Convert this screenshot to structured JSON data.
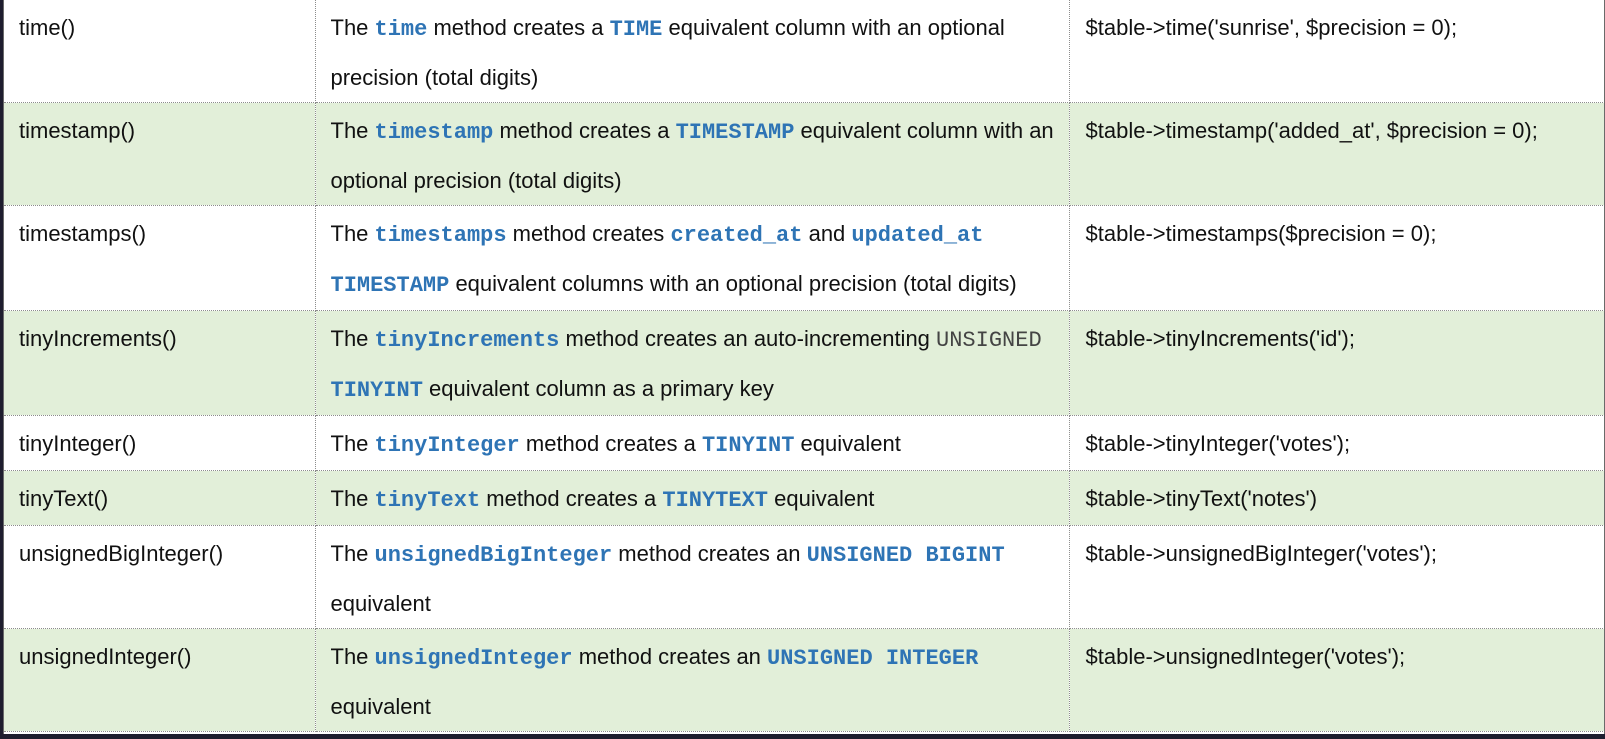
{
  "rows": [
    {
      "method": "time()",
      "desc": [
        {
          "t": "The ",
          "k": "text"
        },
        {
          "t": "time",
          "k": "kw"
        },
        {
          "t": " method creates a ",
          "k": "text"
        },
        {
          "t": "TIME",
          "k": "kw"
        },
        {
          "t": " equivalent column with an optional precision (total digits)",
          "k": "text"
        }
      ],
      "example": "$table->time('sunrise', $precision = 0);"
    },
    {
      "method": "timestamp()",
      "desc": [
        {
          "t": "The ",
          "k": "text"
        },
        {
          "t": "timestamp",
          "k": "kw"
        },
        {
          "t": " method creates a ",
          "k": "text"
        },
        {
          "t": "TIMESTAMP",
          "k": "kw"
        },
        {
          "t": " equivalent column with an optional precision (total digits)",
          "k": "text"
        }
      ],
      "example": "$table->timestamp('added_at', $precision = 0);"
    },
    {
      "method": "timestamps()",
      "desc": [
        {
          "t": "The ",
          "k": "text"
        },
        {
          "t": "timestamps",
          "k": "kw"
        },
        {
          "t": " method creates ",
          "k": "text"
        },
        {
          "t": "created_at",
          "k": "kw"
        },
        {
          "t": " and ",
          "k": "text"
        },
        {
          "t": "updated_at",
          "k": "kw"
        },
        {
          "t": " ",
          "k": "text"
        },
        {
          "t": "TIMESTAMP",
          "k": "kw"
        },
        {
          "t": " equivalent columns with an optional precision (total digits)",
          "k": "text"
        }
      ],
      "example": "$table->timestamps($precision = 0);"
    },
    {
      "method": "tinyIncrements()",
      "desc": [
        {
          "t": "The ",
          "k": "text"
        },
        {
          "t": "tinyIncrements",
          "k": "kw"
        },
        {
          "t": " method creates an auto-incrementing ",
          "k": "text"
        },
        {
          "t": "UNSIGNED",
          "k": "plain"
        },
        {
          "t": " ",
          "k": "text"
        },
        {
          "t": "TINYINT",
          "k": "kw"
        },
        {
          "t": " equivalent column as a primary key",
          "k": "text"
        }
      ],
      "example": "$table->tinyIncrements('id');"
    },
    {
      "method": "tinyInteger()",
      "desc": [
        {
          "t": "The ",
          "k": "text"
        },
        {
          "t": "tinyInteger",
          "k": "kw"
        },
        {
          "t": " method creates a ",
          "k": "text"
        },
        {
          "t": "TINYINT",
          "k": "kw"
        },
        {
          "t": " equivalent",
          "k": "text"
        }
      ],
      "example": "$table->tinyInteger('votes');"
    },
    {
      "method": "tinyText()",
      "desc": [
        {
          "t": "The ",
          "k": "text"
        },
        {
          "t": "tinyText",
          "k": "kw"
        },
        {
          "t": " method creates a ",
          "k": "text"
        },
        {
          "t": "TINYTEXT",
          "k": "kw"
        },
        {
          "t": " equivalent",
          "k": "text"
        }
      ],
      "example": "$table->tinyText('notes')"
    },
    {
      "method": "unsignedBigInteger()",
      "desc": [
        {
          "t": "The ",
          "k": "text"
        },
        {
          "t": "unsignedBigInteger",
          "k": "kw"
        },
        {
          "t": " method creates an ",
          "k": "text"
        },
        {
          "t": "UNSIGNED BIGINT",
          "k": "kw"
        },
        {
          "t": " equivalent",
          "k": "text"
        }
      ],
      "example": "$table->unsignedBigInteger('votes');"
    },
    {
      "method": "unsignedInteger()",
      "desc": [
        {
          "t": "The ",
          "k": "text"
        },
        {
          "t": "unsignedInteger",
          "k": "kw"
        },
        {
          "t": " method creates an ",
          "k": "text"
        },
        {
          "t": "UNSIGNED INTEGER",
          "k": "kw"
        },
        {
          "t": " equivalent",
          "k": "text"
        }
      ],
      "example": "$table->unsignedInteger('votes');"
    }
  ],
  "colors": {
    "keyword": "#2e74b5",
    "row_shade": "#e2efd9",
    "frame": "#1e1d2e"
  }
}
